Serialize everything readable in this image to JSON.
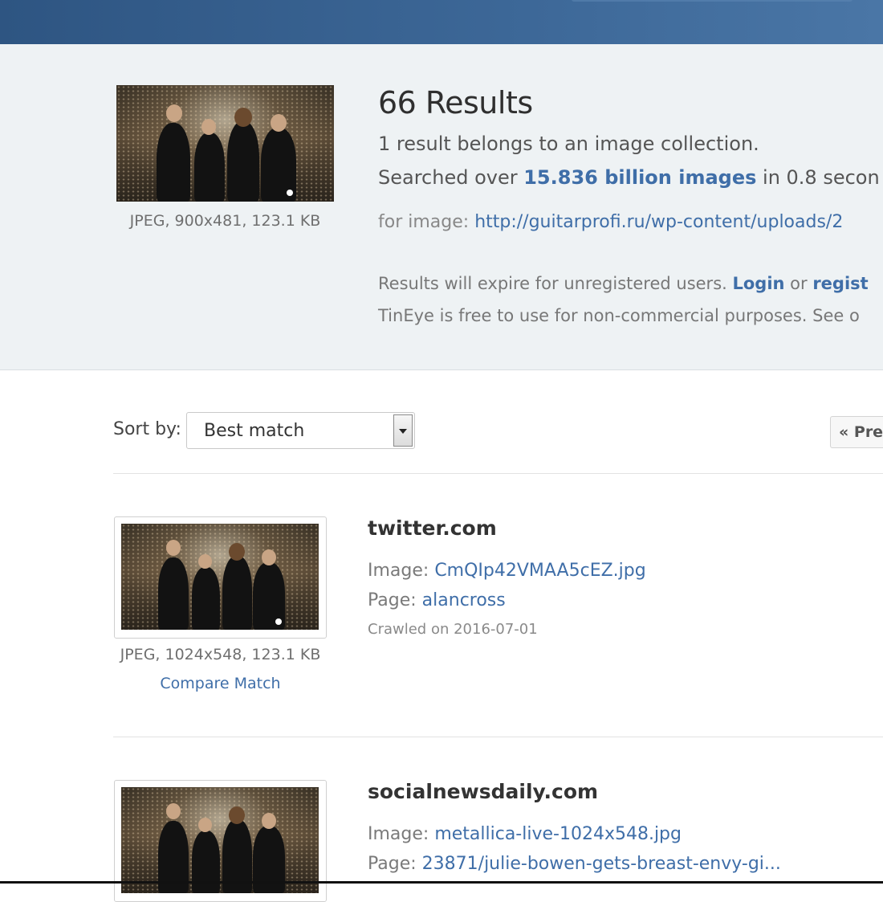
{
  "query": {
    "image_meta": "JPEG, 900x481, 123.1 KB",
    "results_title": "66 Results",
    "collection_note": "1 result belongs to an image collection.",
    "searched_prefix": "Searched over ",
    "searched_count": "15.836 billion images",
    "searched_suffix": " in 0.8 secon",
    "for_image_label": "for image: ",
    "for_image_url": "http://guitarprofi.ru/wp-content/uploads/2",
    "expire_prefix": "Results will expire for unregistered users. ",
    "login_label": "Login",
    "expire_or": " or ",
    "register_label": "regist",
    "free_use_text": "TinEye is free to use for non-commercial purposes. See o"
  },
  "toolbar": {
    "sort_label": "Sort by:",
    "sort_value": "Best match",
    "prev_label": "« Prev"
  },
  "results": [
    {
      "domain": "twitter.com",
      "image_label": "Image: ",
      "image_name": "CmQIp42VMAA5cEZ.jpg",
      "page_label": "Page: ",
      "page_name": "alancross",
      "crawled": "Crawled on 2016-07-01",
      "meta": "JPEG, 1024x548, 123.1 KB",
      "compare_label": "Compare Match"
    },
    {
      "domain": "socialnewsdaily.com",
      "image_label": "Image: ",
      "image_name": "metallica-live-1024x548.jpg",
      "page_label": "Page: ",
      "page_name": "23871/julie-bowen-gets-breast-envy-gi..."
    }
  ],
  "colors": {
    "header_bar": "#3d6898",
    "summary_bg": "#eef2f4",
    "link": "#3f6ea8"
  }
}
